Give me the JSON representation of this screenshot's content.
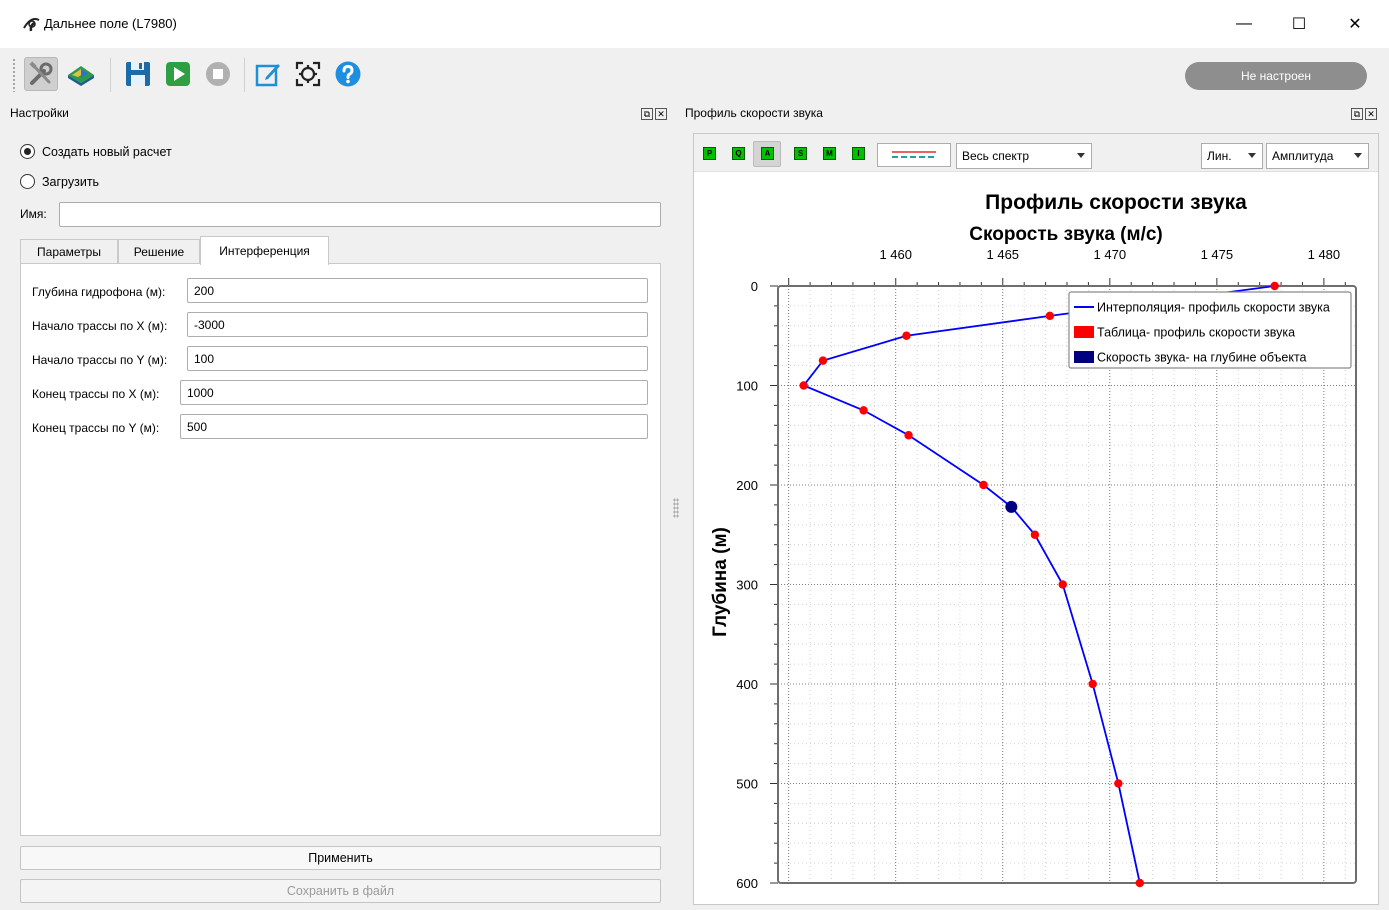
{
  "window": {
    "title": "Дальнее поле (L7980)",
    "minimize_glyph": "—",
    "maximize_glyph": "☐",
    "close_glyph": "✕"
  },
  "toolbar": {
    "status": "Не настроен",
    "icons": [
      "tools-icon",
      "terrain-map-icon",
      "save-icon",
      "play-icon",
      "stop-icon",
      "edit-icon",
      "crosshair-icon",
      "help-icon"
    ]
  },
  "settings_panel": {
    "title": "Настройки",
    "radio_new": "Создать новый расчет",
    "radio_load": "Загрузить",
    "name_label": "Имя:",
    "name_value": "",
    "tabs": [
      "Параметры",
      "Решение",
      "Интерференция"
    ],
    "active_tab": "Интерференция",
    "fields": [
      {
        "label": "Глубина гидрофона (м):",
        "value": "200"
      },
      {
        "label": "Начало трассы по X (м):",
        "value": "-3000"
      },
      {
        "label": "Начало трассы по Y (м):",
        "value": "100"
      },
      {
        "label": "Конец трассы по X (м):",
        "value": "1000"
      },
      {
        "label": "Конец трассы по Y (м):",
        "value": "500"
      }
    ],
    "apply_button": "Применить",
    "save_button": "Сохранить в файл"
  },
  "chart_panel": {
    "title": "Профиль скорости звука",
    "tool_buttons": [
      "P",
      "Q",
      "A",
      "S",
      "M",
      "I"
    ],
    "spectrum_combo": "Весь спектр",
    "scale_combo": "Лин.",
    "mode_combo": "Амплитуда"
  },
  "chart_data": {
    "type": "line",
    "title": "Профиль скорости звука",
    "xlabel": "Скорость звука (м/с)",
    "ylabel": "Глубина (м)",
    "xlim": [
      1454.5,
      1481.5
    ],
    "ylim": [
      0,
      600
    ],
    "y_inverted": true,
    "x_axis_position": "top",
    "x_ticks": [
      "1 460",
      "1 465",
      "1 470",
      "1 475",
      "1 480"
    ],
    "x_tick_values": [
      1460,
      1465,
      1470,
      1475,
      1480
    ],
    "y_ticks": [
      "0",
      "100",
      "200",
      "300",
      "400",
      "500",
      "600"
    ],
    "y_tick_values": [
      0,
      100,
      200,
      300,
      400,
      500,
      600
    ],
    "grid": true,
    "legend_position": "top-right",
    "series": [
      {
        "name": "Интерполяция- профиль скорости звука",
        "color": "#0000ff",
        "x": [
          1477.7,
          1467.2,
          1460.5,
          1456.6,
          1455.7,
          1458.5,
          1460.6,
          1464.1,
          1465.4,
          1466.5,
          1467.8,
          1469.2,
          1470.4,
          1471.4
        ],
        "y": [
          0,
          30,
          50,
          75,
          100,
          125,
          150,
          200,
          222,
          250,
          300,
          400,
          500,
          600
        ]
      },
      {
        "name": "Таблица- профиль скорости звука",
        "color": "#ff0000",
        "x": [
          1477.7,
          1467.2,
          1460.5,
          1456.6,
          1455.7,
          1458.5,
          1460.6,
          1464.1,
          1466.5,
          1467.8,
          1469.2,
          1470.4,
          1471.4
        ],
        "y": [
          0,
          30,
          50,
          75,
          100,
          125,
          150,
          200,
          250,
          300,
          400,
          500,
          600
        ]
      },
      {
        "name": "Скорость звука- на глубине объекта",
        "color": "#00007f",
        "x": [
          1465.4
        ],
        "y": [
          222
        ]
      }
    ]
  }
}
